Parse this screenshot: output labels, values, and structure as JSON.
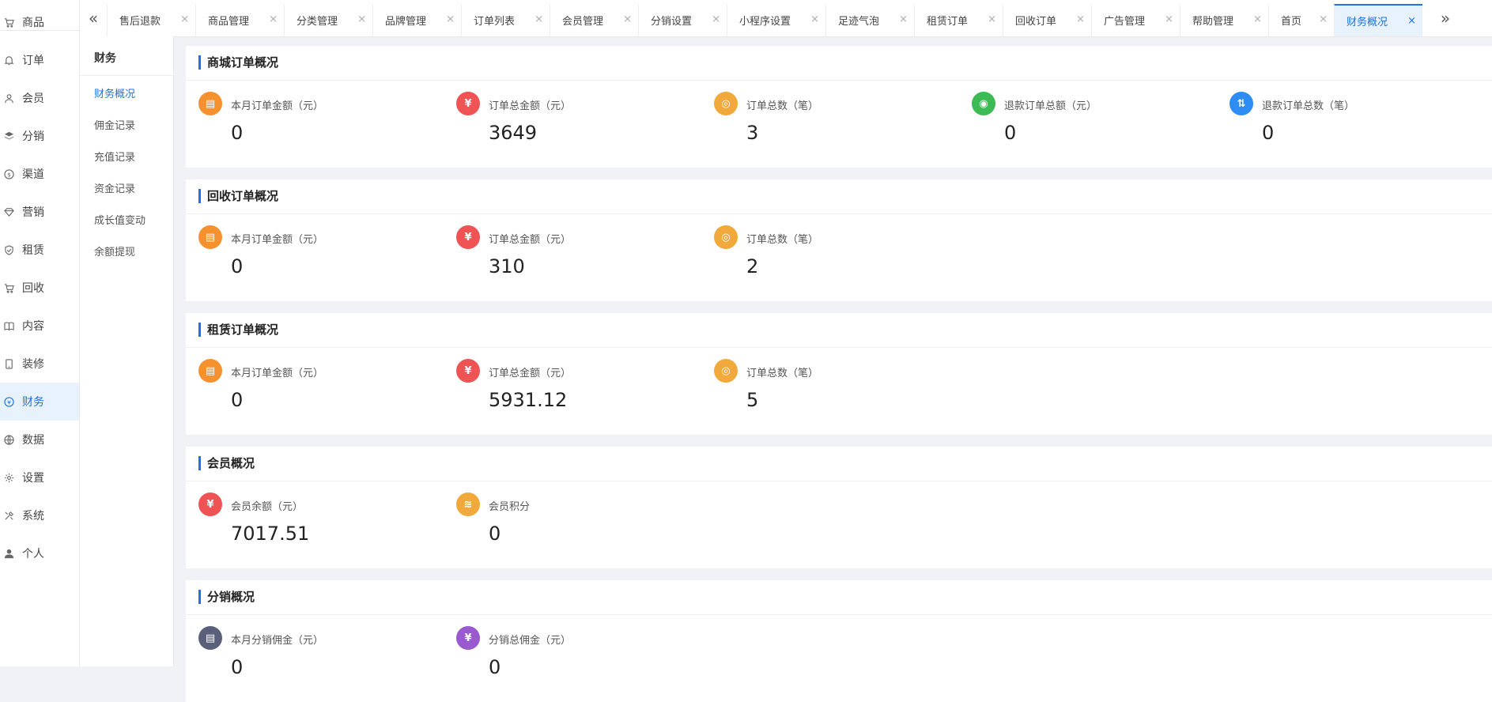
{
  "colors": {
    "accent": "#1a73e8",
    "orange": "#f5922f",
    "red": "#f05353",
    "amber": "#f2a93b",
    "green": "#3cba54",
    "blue": "#2f8cf5",
    "slate": "#5a6079",
    "purple": "#9b59d0"
  },
  "left_nav": {
    "items": [
      {
        "label": "商品",
        "icon": "cart-icon"
      },
      {
        "label": "订单",
        "icon": "bell-icon"
      },
      {
        "label": "会员",
        "icon": "user-icon"
      },
      {
        "label": "分销",
        "icon": "layers-icon"
      },
      {
        "label": "渠道",
        "icon": "dollar-icon"
      },
      {
        "label": "营销",
        "icon": "diamond-icon"
      },
      {
        "label": "租赁",
        "icon": "shield-icon"
      },
      {
        "label": "回收",
        "icon": "cart-icon"
      },
      {
        "label": "内容",
        "icon": "book-icon"
      },
      {
        "label": "装修",
        "icon": "phone-icon"
      },
      {
        "label": "财务",
        "icon": "yen-icon"
      },
      {
        "label": "数据",
        "icon": "globe-icon"
      },
      {
        "label": "设置",
        "icon": "gear-icon"
      },
      {
        "label": "系统",
        "icon": "tools-icon"
      },
      {
        "label": "个人",
        "icon": "person-icon"
      }
    ],
    "active_index": 10
  },
  "sub_nav": {
    "title": "财务",
    "items": [
      "财务概况",
      "佣金记录",
      "充值记录",
      "资金记录",
      "成长值变动",
      "余额提现"
    ],
    "active_index": 0
  },
  "tabs": {
    "items": [
      "售后退款",
      "商品管理",
      "分类管理",
      "品牌管理",
      "订单列表",
      "会员管理",
      "分销设置",
      "小程序设置",
      "足迹气泡",
      "租赁订单",
      "回收订单",
      "广告管理",
      "帮助管理",
      "首页",
      "财务概况"
    ],
    "active_index": 14,
    "close_glyph": "×",
    "prev_glyph": "«",
    "next_glyph": "»"
  },
  "sections": [
    {
      "title": "商城订单概况",
      "stats": [
        {
          "label": "本月订单金额（元）",
          "value": "0",
          "icon": "clipboard-icon",
          "color": "orange",
          "glyph": "▤"
        },
        {
          "label": "订单总金额（元）",
          "value": "3649",
          "icon": "yen-icon",
          "color": "red",
          "glyph": "¥"
        },
        {
          "label": "订单总数（笔）",
          "value": "3",
          "icon": "coin-icon",
          "color": "amber",
          "glyph": "◎"
        },
        {
          "label": "退款订单总额（元）",
          "value": "0",
          "icon": "refund-coin-icon",
          "color": "green",
          "glyph": "◉"
        },
        {
          "label": "退款订单总数（笔）",
          "value": "0",
          "icon": "transfer-icon",
          "color": "blue",
          "glyph": "⇅"
        }
      ]
    },
    {
      "title": "回收订单概况",
      "stats": [
        {
          "label": "本月订单金额（元）",
          "value": "0",
          "icon": "clipboard-icon",
          "color": "orange",
          "glyph": "▤"
        },
        {
          "label": "订单总金额（元）",
          "value": "310",
          "icon": "yen-icon",
          "color": "red",
          "glyph": "¥"
        },
        {
          "label": "订单总数（笔）",
          "value": "2",
          "icon": "coin-icon",
          "color": "amber",
          "glyph": "◎"
        }
      ]
    },
    {
      "title": "租赁订单概况",
      "stats": [
        {
          "label": "本月订单金额（元）",
          "value": "0",
          "icon": "clipboard-icon",
          "color": "orange",
          "glyph": "▤"
        },
        {
          "label": "订单总金额（元）",
          "value": "5931.12",
          "icon": "yen-icon",
          "color": "red",
          "glyph": "¥"
        },
        {
          "label": "订单总数（笔）",
          "value": "5",
          "icon": "coin-icon",
          "color": "amber",
          "glyph": "◎"
        }
      ]
    },
    {
      "title": "会员概况",
      "stats": [
        {
          "label": "会员余额（元）",
          "value": "7017.51",
          "icon": "yen-icon",
          "color": "red",
          "glyph": "¥"
        },
        {
          "label": "会员积分",
          "value": "0",
          "icon": "coins-stack-icon",
          "color": "amber",
          "glyph": "≋"
        }
      ]
    },
    {
      "title": "分销概况",
      "stats": [
        {
          "label": "本月分销佣金（元）",
          "value": "0",
          "icon": "clipboard-icon",
          "color": "slate",
          "glyph": "▤"
        },
        {
          "label": "分销总佣金（元）",
          "value": "0",
          "icon": "yen-icon",
          "color": "purple",
          "glyph": "¥"
        }
      ]
    }
  ]
}
